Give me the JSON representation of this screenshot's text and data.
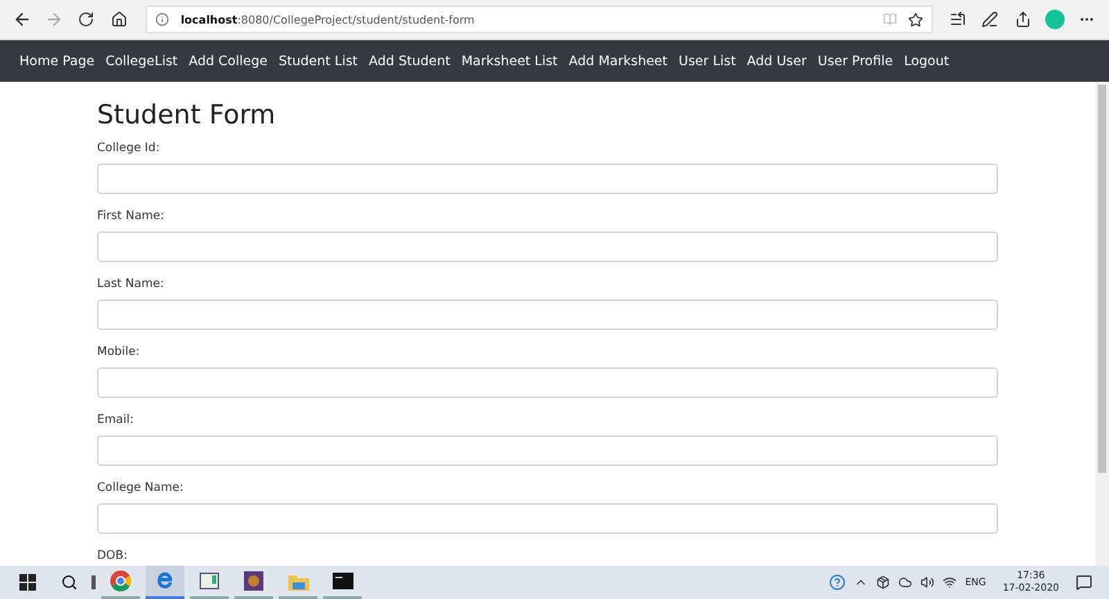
{
  "browser": {
    "url": "**localhost**:8080/CollegeProject/student/student-form"
  },
  "nav": {
    "items": [
      {
        "label": "Home Page"
      },
      {
        "label": "CollegeList"
      },
      {
        "label": "Add College"
      },
      {
        "label": "Student List"
      },
      {
        "label": "Add Student"
      },
      {
        "label": "Marksheet List"
      },
      {
        "label": "Add Marksheet"
      },
      {
        "label": "User List"
      },
      {
        "label": "Add User"
      },
      {
        "label": "User Profile"
      },
      {
        "label": "Logout"
      }
    ]
  },
  "form": {
    "title": "Student Form",
    "fields": [
      {
        "label": "College Id:",
        "kind": "input"
      },
      {
        "label": "First Name:",
        "kind": "input"
      },
      {
        "label": "Last Name:",
        "kind": "input"
      },
      {
        "label": "Mobile:",
        "kind": "input"
      },
      {
        "label": "Email:",
        "kind": "input"
      },
      {
        "label": "College Name:",
        "kind": "input"
      },
      {
        "label": "DOB:",
        "kind": "label"
      }
    ]
  },
  "taskbar": {
    "apps": [
      {
        "kind": "chrome",
        "active": false
      },
      {
        "kind": "edge",
        "active": true
      },
      {
        "kind": "window",
        "active": false
      },
      {
        "kind": "emblem",
        "active": false
      },
      {
        "kind": "folder",
        "active": false
      },
      {
        "kind": "terminal",
        "active": false
      }
    ],
    "language": "ENG",
    "time": "17:36",
    "date": "17-02-2020"
  }
}
